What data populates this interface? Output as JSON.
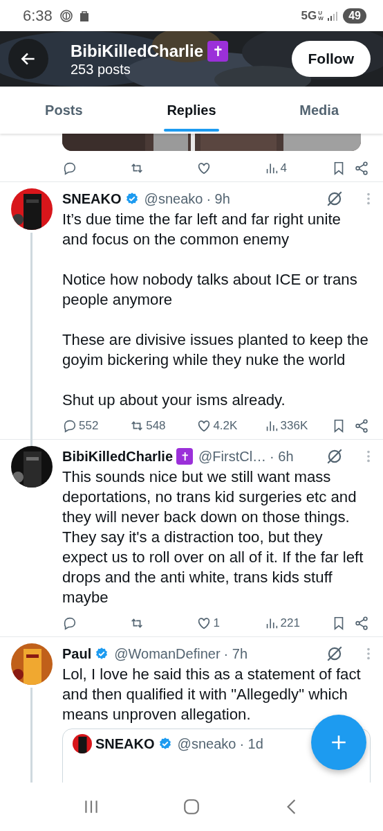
{
  "status_bar": {
    "time": "6:38",
    "network": "5G",
    "network_sub": "UW",
    "battery": "49"
  },
  "header": {
    "name": "BibiKilledCharlie",
    "name_badge": "✝",
    "posts": "253 posts",
    "follow": "Follow"
  },
  "tabs": [
    {
      "label": "Posts",
      "selected": false
    },
    {
      "label": "Replies",
      "selected": true
    },
    {
      "label": "Media",
      "selected": false
    }
  ],
  "feed": [
    {
      "kind": "partial",
      "actions": [
        {
          "kind": "reply"
        },
        {
          "kind": "repost"
        },
        {
          "kind": "like"
        },
        {
          "kind": "views",
          "count": "4"
        },
        {
          "kind": "bookmark"
        },
        {
          "kind": "share"
        }
      ]
    },
    {
      "kind": "tweet",
      "thread_line": true,
      "name": "SNEAKO",
      "verified": true,
      "handle": "@sneako",
      "time": "· 9h",
      "paragraphs": [
        "It’s due time the far left and far right unite and focus on the common enemy",
        "Notice how nobody talks about ICE or trans people anymore",
        "These are divisive issues planted to keep the goyim bickering while they nuke the world",
        "Shut up about your isms already."
      ],
      "actions": [
        {
          "kind": "reply",
          "count": "552"
        },
        {
          "kind": "repost",
          "count": "548"
        },
        {
          "kind": "like",
          "count": "4.2K"
        },
        {
          "kind": "views",
          "count": "336K"
        },
        {
          "kind": "bookmark"
        },
        {
          "kind": "share"
        }
      ]
    },
    {
      "kind": "tweet",
      "name": "BibiKilledCharlie",
      "name_badge": "✝",
      "handle": "@FirstCl…",
      "time": "· 6h",
      "paragraphs": [
        "This sounds nice but we still want mass deportations, no trans kid surgeries etc and they will never back down on those things. They say it's a distraction too, but they expect us to roll over on all of it. If the far left drops and the anti white, trans kids stuff maybe"
      ],
      "actions": [
        {
          "kind": "reply"
        },
        {
          "kind": "repost"
        },
        {
          "kind": "like",
          "count": "1"
        },
        {
          "kind": "views",
          "count": "221"
        },
        {
          "kind": "bookmark"
        },
        {
          "kind": "share"
        }
      ]
    },
    {
      "kind": "tweet",
      "thread_line": true,
      "name": "Paul",
      "verified": true,
      "handle": "@WomanDefiner",
      "time": "· 7h",
      "paragraphs": [
        "Lol, I love he said this as a statement of fact and then qualified it with \"Allegedly\" which means unproven allegation."
      ],
      "quote": {
        "name": "SNEAKO",
        "verified": true,
        "handle": "@sneako",
        "time": "· 1d"
      }
    }
  ]
}
